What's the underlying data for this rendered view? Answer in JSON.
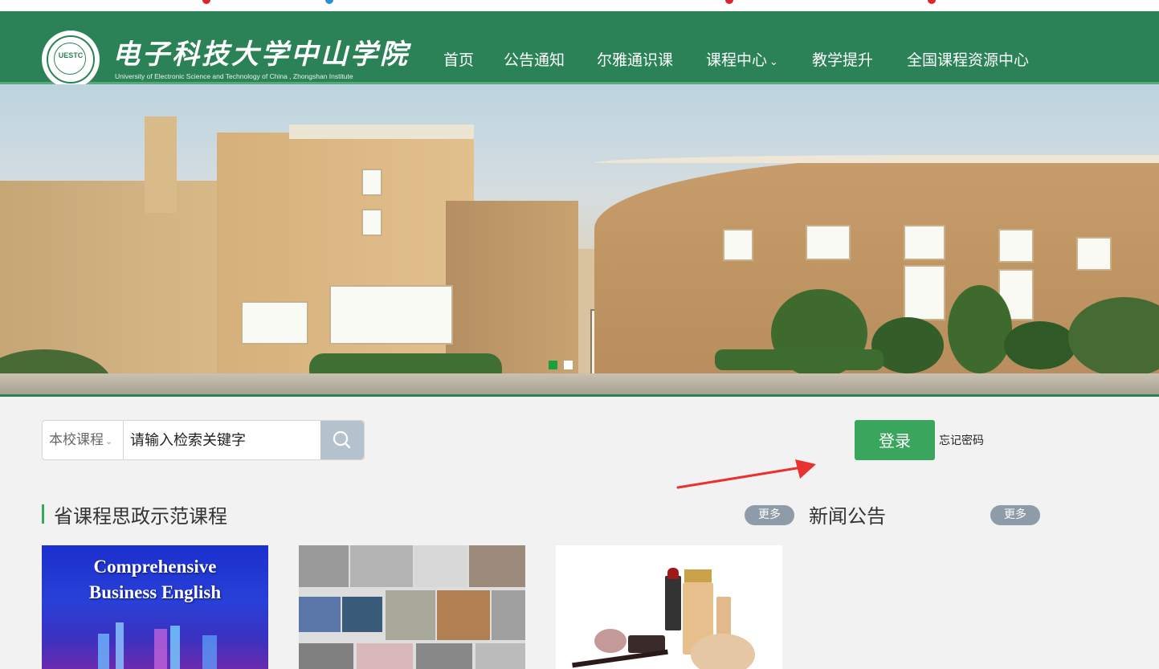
{
  "header": {
    "logo_cn": "电子科技大学中山学院",
    "logo_en": "University of Electronic Science and Technology of China , Zhongshan Institute",
    "logo_abbr": "UESTC",
    "nav": [
      "首页",
      "公告通知",
      "尔雅通识课",
      "课程中心",
      "教学提升",
      "全国课程资源中心"
    ]
  },
  "banner": {
    "slide_count": 2,
    "active_slide": 1,
    "dot_colors": [
      "#19a03c",
      "#ffffff"
    ]
  },
  "search": {
    "category": "本校课程",
    "placeholder": "请输入检索关键字"
  },
  "login": {
    "button_label": "登录",
    "forgot_label": "忘记密码"
  },
  "sections": {
    "courses_title": "省课程思政示范课程",
    "courses_more": "更多",
    "news_title": "新闻公告",
    "news_more": "更多"
  },
  "cards": [
    {
      "line1": "Comprehensive",
      "line2": "Business English"
    },
    {},
    {}
  ],
  "colors": {
    "header_green": "#2b8257",
    "accent_green": "#3aa55c",
    "more_gray": "#8d9ca8",
    "arrow_red": "#e8322e"
  }
}
